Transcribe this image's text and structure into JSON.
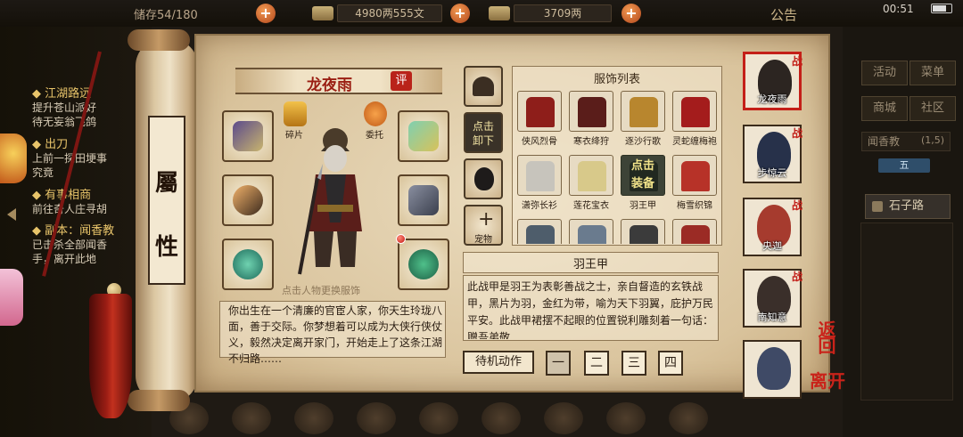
{
  "topbar": {
    "count_text": "储存54/180",
    "copper": "4980两555文",
    "silver": "3709两",
    "announce": "公告",
    "time": "00:51"
  },
  "quests": [
    {
      "title": "◆ 江湖路远",
      "lines": [
        "提升苍山派好",
        "待无妄翁飞鸽"
      ]
    },
    {
      "title": "◆ 出刀",
      "lines": [
        "上前一探田埂事",
        "究竟"
      ]
    },
    {
      "title": "◆ 有事相商",
      "lines": [
        "前往奇人庄寻胡"
      ]
    },
    {
      "title": "◆ 副本：闻香教",
      "lines": [
        "已击杀全部闻香",
        "手，离开此地"
      ]
    }
  ],
  "scroll": {
    "attr_char1": "屬",
    "attr_char2": "性"
  },
  "character": {
    "name": "龙夜雨",
    "rate_label": "评",
    "fragments_label": "碎片",
    "entrust_label": "委托",
    "hint": "点击人物更换服饰",
    "bio": "你出生在一个清廉的官宦人家，你天生玲珑八面，善于交际。你梦想着可以成为大侠行侠仗义，毅然决定离开家门，开始走上了这条江湖不归路……"
  },
  "side_column": {
    "unequip_line1": "点击",
    "unequip_line2": "卸下",
    "pet_label": "宠物"
  },
  "costume_list": {
    "title": "服饰列表",
    "items": [
      {
        "name": "侠风烈骨",
        "color": "#8e1e1a"
      },
      {
        "name": "寒衣绛狩",
        "color": "#5a1d1a"
      },
      {
        "name": "逐沙行歌",
        "color": "#b8862e"
      },
      {
        "name": "灵蛇缠梅袍",
        "color": "#a41c1c"
      },
      {
        "name": "潇弥长衫",
        "color": "#c7c4bc"
      },
      {
        "name": "莲花宝衣",
        "color": "#d8c98a"
      },
      {
        "name": "羽王甲",
        "color": "#2e2a2a",
        "equipped": true
      },
      {
        "name": "梅雪织锦",
        "color": "#b73228"
      },
      {
        "name": "",
        "color": "#4e5d6b"
      },
      {
        "name": "",
        "color": "#6a7b8e"
      },
      {
        "name": "",
        "color": "#3b3b3b"
      },
      {
        "name": "",
        "color": "#9b2b25"
      }
    ],
    "equip_line1": "点击",
    "equip_line2": "装备"
  },
  "detail": {
    "title": "羽王甲",
    "text": "此战甲是羽王为表彰善战之士，亲自督造的玄铁战甲，黑片为羽，金红为带，喻为天下羽翼，庇护万民平安。此战甲裙摆不起眼的位置锐利雕刻着一句话：赠吾弟敬"
  },
  "idle": {
    "label": "待机动作",
    "options": [
      "一",
      "二",
      "三",
      "四"
    ]
  },
  "party": [
    {
      "name": "龙夜雨",
      "tag": "战",
      "color": "#2c2521"
    },
    {
      "name": "步惊云",
      "tag": "战",
      "color": "#27314a"
    },
    {
      "name": "央迦",
      "tag": "战",
      "color": "#a63b2e"
    },
    {
      "name": "南知意",
      "tag": "战",
      "color": "#3a2f2a"
    },
    {
      "name": "",
      "tag": "",
      "color": "#3f4a66"
    }
  ],
  "actions": {
    "back": "返回",
    "leave": "离开"
  },
  "right_menu": {
    "items": [
      "活动",
      "菜单",
      "商城",
      "社区"
    ],
    "region": "闻香教",
    "region_num": "(1,5)",
    "tag": "五",
    "location": "石子路"
  },
  "colors": {
    "accent_red": "#c41f18",
    "parchment": "#e3d2b2",
    "dark": "#1f1a14"
  }
}
